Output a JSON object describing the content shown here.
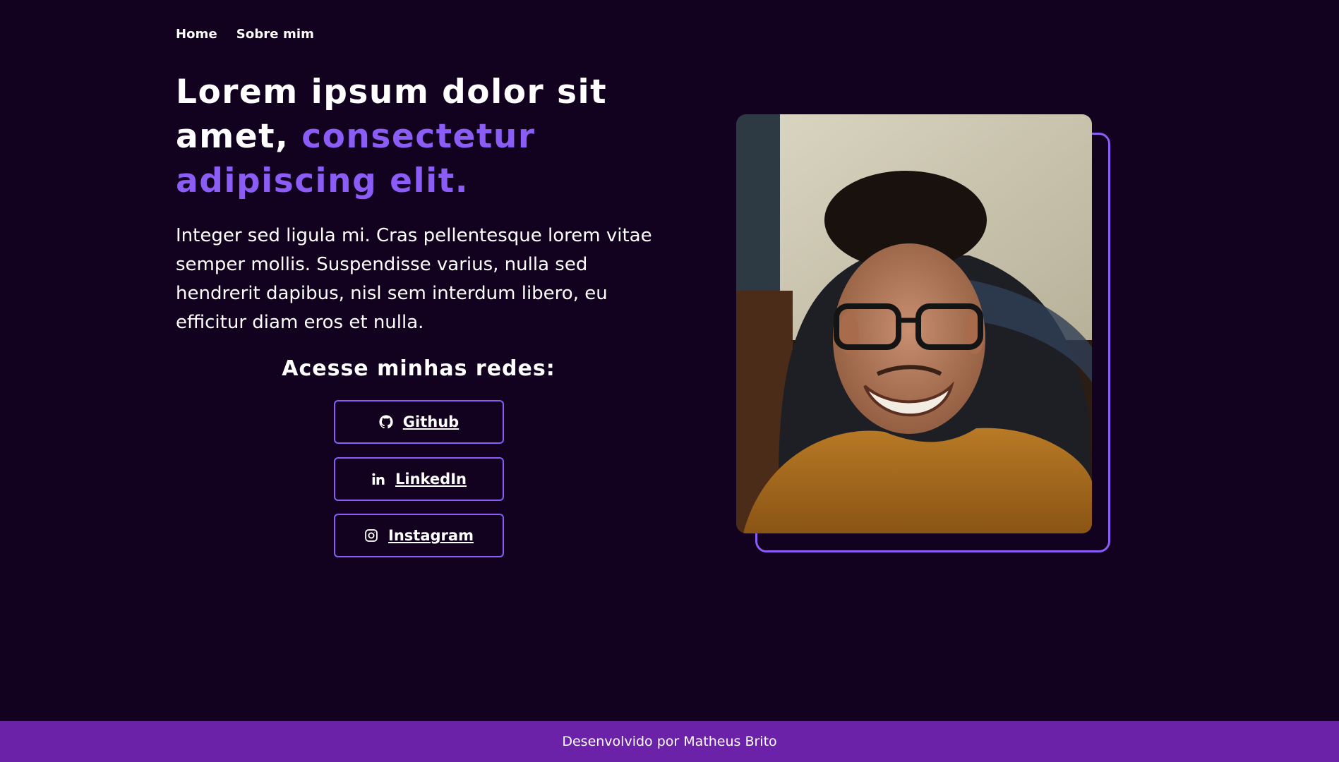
{
  "nav": {
    "items": [
      {
        "label": "Home"
      },
      {
        "label": "Sobre mim"
      }
    ]
  },
  "hero": {
    "title_main": "Lorem ipsum dolor sit amet,",
    "title_accent": "consectetur adipiscing elit.",
    "description": "Integer sed ligula mi. Cras pellentesque lorem vitae semper mollis. Suspendisse varius, nulla sed hendrerit dapibus, nisl sem interdum libero, eu efficitur diam eros et nulla."
  },
  "socials": {
    "title": "Acesse minhas redes:",
    "buttons": [
      {
        "label": "Github",
        "icon": "github-icon"
      },
      {
        "label": "LinkedIn",
        "icon": "linkedin-icon"
      },
      {
        "label": "Instagram",
        "icon": "instagram-icon"
      }
    ]
  },
  "profile_photo": {
    "subject": "portrait-photo"
  },
  "footer": {
    "text": "Desenvolvido por Matheus Brito"
  },
  "colors": {
    "background": "#12021f",
    "accent": "#8b5cf6",
    "footer": "#6b21a8",
    "text": "#ffffff"
  }
}
